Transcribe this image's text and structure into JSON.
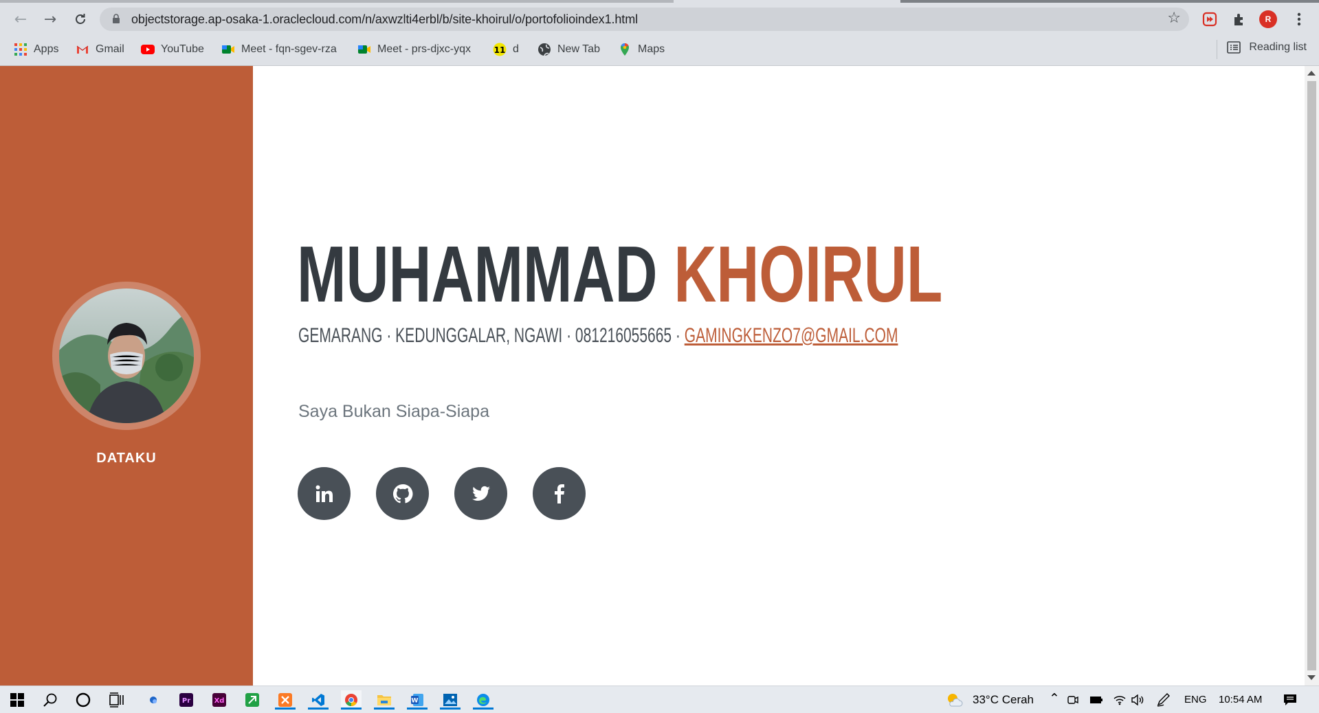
{
  "browser": {
    "url": "objectstorage.ap-osaka-1.oraclecloud.com/n/axwzlti4erbl/b/site-khoirul/o/portofolioindex1.html",
    "profile_initial": "R",
    "bookmarks": [
      {
        "label": "Apps",
        "icon": "apps-grid-icon"
      },
      {
        "label": "Gmail",
        "icon": "gmail-icon"
      },
      {
        "label": "YouTube",
        "icon": "youtube-icon"
      },
      {
        "label": "Meet - fqn-sgev-rza",
        "icon": "meet-icon"
      },
      {
        "label": "Meet - prs-djxc-yqx",
        "icon": "meet-icon"
      },
      {
        "label": "d",
        "icon": "badge-11-icon"
      },
      {
        "label": "New Tab",
        "icon": "globe-icon"
      },
      {
        "label": "Maps",
        "icon": "maps-pin-icon"
      }
    ],
    "reading_list": "Reading list"
  },
  "sidebar": {
    "nav_label": "DATAKU",
    "color": "#bd5d38"
  },
  "profile": {
    "first_name": "MUHAMMAD",
    "last_name": "KHOIRUL",
    "address": "GEMARANG · KEDUNGGALAR, NGAWI · 081216055665 ·",
    "email": "GAMINGKENZO7@GMAIL.COM",
    "tagline": "Saya Bukan Siapa-Siapa",
    "socials": [
      "linkedin-icon",
      "github-icon",
      "twitter-icon",
      "facebook-icon"
    ]
  },
  "taskbar": {
    "weather": "33°C  Cerah",
    "language": "ENG",
    "time": "10:54 AM"
  }
}
